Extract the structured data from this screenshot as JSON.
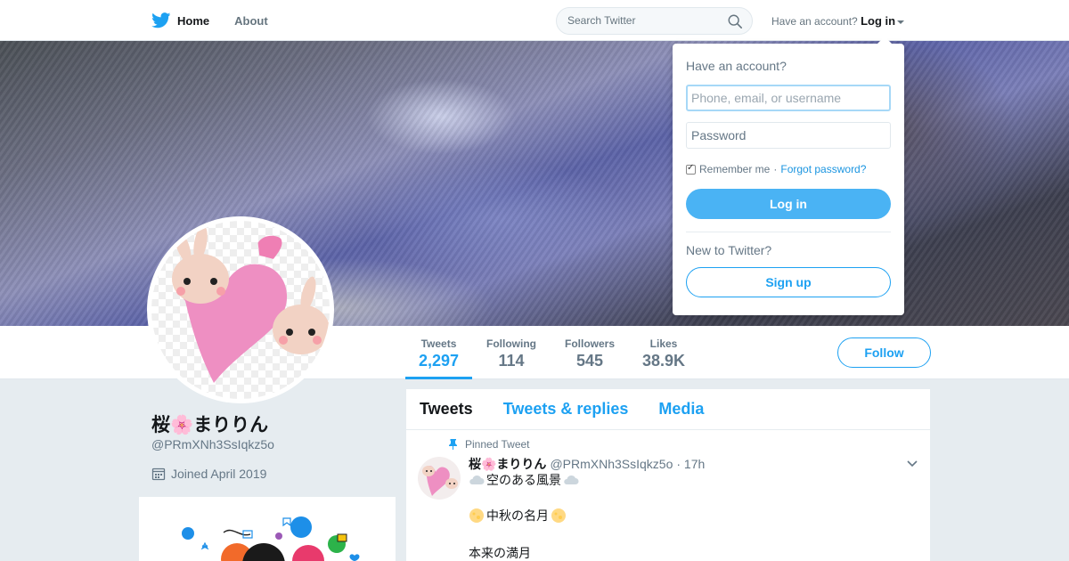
{
  "nav": {
    "home_label": "Home",
    "about_label": "About",
    "search_placeholder": "Search Twitter",
    "account_prompt": "Have an account?",
    "login_label": "Log in"
  },
  "profile": {
    "display_name": "桜🌸まりりん",
    "handle": "@PRmXNh3SsIqkz5o",
    "joined": "Joined April 2019",
    "stats": [
      {
        "label": "Tweets",
        "value": "2,297"
      },
      {
        "label": "Following",
        "value": "114"
      },
      {
        "label": "Followers",
        "value": "545"
      },
      {
        "label": "Likes",
        "value": "38.9K"
      }
    ],
    "follow_label": "Follow"
  },
  "timeline": {
    "tabs": [
      "Tweets",
      "Tweets & replies",
      "Media"
    ],
    "pinned_label": "Pinned Tweet",
    "tweet": {
      "name": "桜🌸まりりん",
      "handle": "@PRmXNh3SsIqkz5o",
      "time": "· 17h",
      "lines": [
        "空のある風景",
        "中秋の名月",
        "本来の満月"
      ]
    }
  },
  "login_dropdown": {
    "title": "Have an account?",
    "username_placeholder": "Phone, email, or username",
    "password_placeholder": "Password",
    "remember_label": "Remember me",
    "separator": "·",
    "forgot_label": "Forgot password?",
    "login_button": "Log in",
    "new_prompt": "New to Twitter?",
    "signup_button": "Sign up"
  },
  "colors": {
    "accent": "#1da1f2",
    "login_button_bg": "#4ab3f4",
    "page_bg": "#e6ecf0"
  }
}
